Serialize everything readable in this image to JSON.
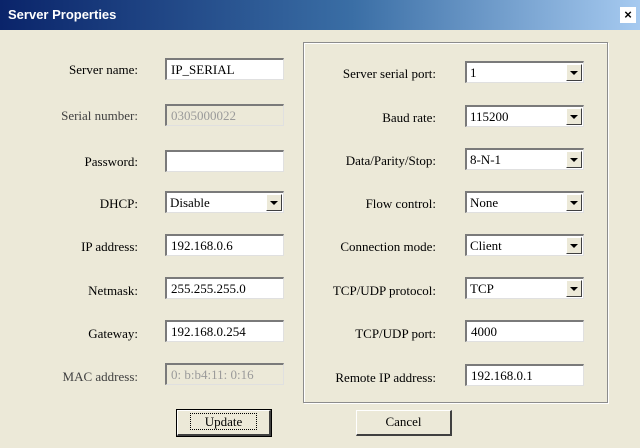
{
  "window": {
    "title": "Server Properties",
    "close_glyph": "×"
  },
  "left": {
    "server_name": {
      "label": "Server name:",
      "value": "IP_SERIAL"
    },
    "serial_number": {
      "label": "Serial number:",
      "value": "0305000022"
    },
    "password": {
      "label": "Password:",
      "value": ""
    },
    "dhcp": {
      "label": "DHCP:",
      "value": "Disable"
    },
    "ip_address": {
      "label": "IP address:",
      "value": "192.168.0.6"
    },
    "netmask": {
      "label": "Netmask:",
      "value": "255.255.255.0"
    },
    "gateway": {
      "label": "Gateway:",
      "value": "192.168.0.254"
    },
    "mac_address": {
      "label": "MAC address:",
      "value": "0: b:b4:11: 0:16"
    }
  },
  "right": {
    "server_serial_port": {
      "label": "Server serial port:",
      "value": "1"
    },
    "baud_rate": {
      "label": "Baud rate:",
      "value": "115200"
    },
    "data_parity_stop": {
      "label": "Data/Parity/Stop:",
      "value": "8-N-1"
    },
    "flow_control": {
      "label": "Flow control:",
      "value": "None"
    },
    "connection_mode": {
      "label": "Connection mode:",
      "value": "Client"
    },
    "tcp_udp_protocol": {
      "label": "TCP/UDP protocol:",
      "value": "TCP"
    },
    "tcp_udp_port": {
      "label": "TCP/UDP port:",
      "value": "4000"
    },
    "remote_ip_address": {
      "label": "Remote IP address:",
      "value": "192.168.0.1"
    }
  },
  "buttons": {
    "update": "Update",
    "cancel": "Cancel"
  }
}
